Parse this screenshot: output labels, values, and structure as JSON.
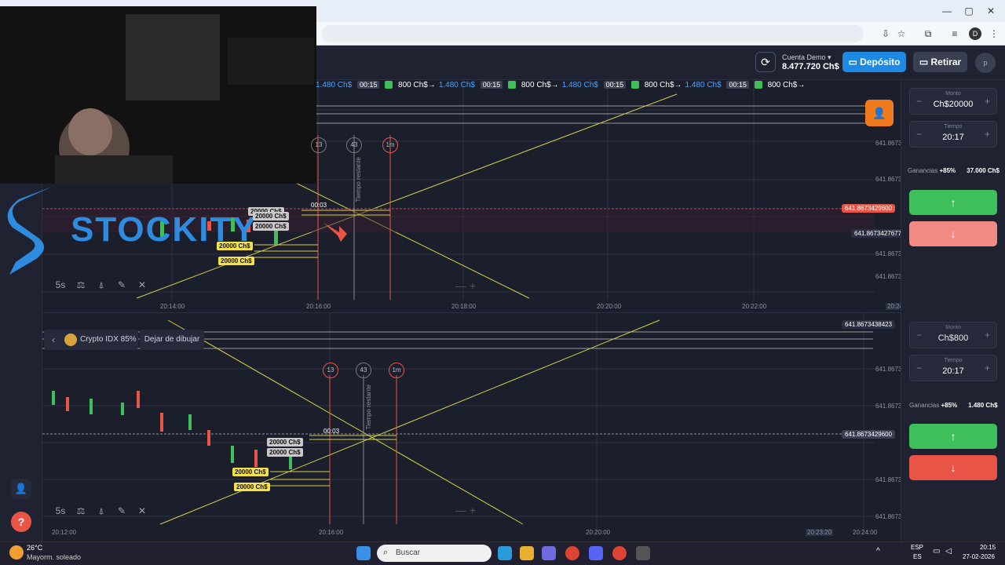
{
  "header": {
    "account_label": "Cuenta Demo",
    "account_balance": "8.477.720 Ch$",
    "deposit_label": "Depósito",
    "withdraw_label": "Retirar",
    "avatar_letter": "p"
  },
  "ticker": [
    {
      "price": "1.480 Ch$",
      "time": "00:15"
    },
    {
      "amount": "800 Ch$→",
      "price": "1.480 Ch$",
      "time": "00:15"
    },
    {
      "amount": "800 Ch$→",
      "price": "1.480 Ch$",
      "time": "00:15"
    },
    {
      "amount": "800 Ch$→",
      "price": "1.480 Ch$",
      "time": "00:15"
    },
    {
      "amount": "800 Ch$→",
      "price": "",
      "time": ""
    }
  ],
  "panel_top": {
    "amount_label": "Monto",
    "amount_value": "Ch$20000",
    "time_label": "Tiempo",
    "time_value": "20:17",
    "gain_label": "Ganancias",
    "gain_pct": "+85%",
    "gain_value": "37.000 Ch$"
  },
  "panel_bottom": {
    "amount_label": "Monto",
    "amount_value": "Ch$800",
    "time_label": "Tiempo",
    "time_value": "20:17",
    "gain_label": "Ganancias",
    "gain_pct": "+85%",
    "gain_value": "1.480 Ch$"
  },
  "chart1": {
    "price_tag": "641.8673429600",
    "price_tag2": "641.8673427677",
    "axis_value": "641.8673",
    "x_ticks": [
      "20:14:00",
      "20:16:00",
      "20:18:00",
      "20:20:00",
      "20:22:00",
      "20:24"
    ],
    "countdown": "00:03",
    "circles": [
      "13",
      "43",
      "1m"
    ],
    "remaining_label": "Tiempo restante",
    "chips": [
      "20000 Ch$",
      "20000 Ch$",
      "20000 Ch$",
      "20000 Ch$",
      "20000 Ch$"
    ],
    "timeframe": "5s"
  },
  "chart2": {
    "price_tag": "641.8673429600",
    "top_tag": "641.8673438423",
    "axis_value": "641.8673",
    "x_ticks": [
      "20:12:00",
      "20:16:00",
      "20:20:00",
      "20:23:20",
      "20:24:00"
    ],
    "countdown": "00:03",
    "circles": [
      "13",
      "43",
      "1m"
    ],
    "remaining_label": "Tiempo restante",
    "chips": [
      "20000 Ch$",
      "20000 Ch$",
      "20000 Ch$",
      "20000 Ch$"
    ],
    "timeframe": "5s",
    "asset_label": "Crypto IDX 85%",
    "stop_drawing_label": "Dejar de dibujar"
  },
  "watermark": "STOCKITY",
  "taskbar": {
    "weather_temp": "26°C",
    "weather_desc": "Mayorm. soleado",
    "search_placeholder": "Buscar",
    "lang": "ESP",
    "lang2": "ES",
    "time": "20:15",
    "date": "27-02-2026"
  },
  "colors": {
    "up": "#3fbf5a",
    "down": "#e85546",
    "accent": "#1e88e5"
  }
}
